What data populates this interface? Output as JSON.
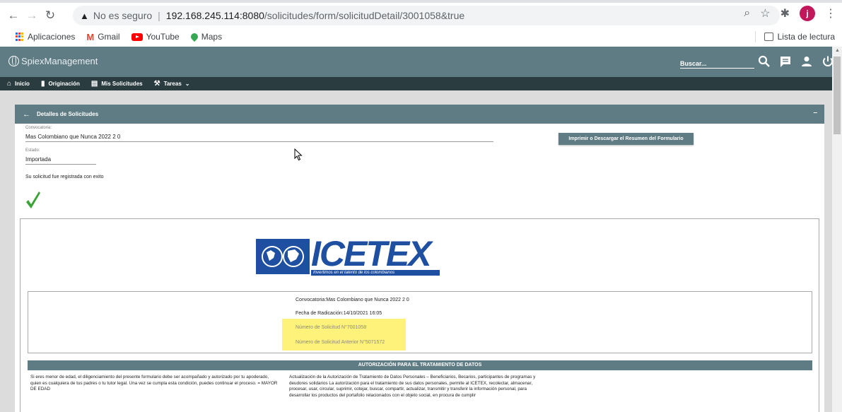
{
  "browser": {
    "url_warning": "No es seguro",
    "url_host": "192.168.245.114:8080",
    "url_path": "/solicitudes/form/solicitudDetail/3001058&true",
    "avatar_letter": "j",
    "bookmarks": [
      {
        "label": "Aplicaciones",
        "icon": "apps-grid-icon"
      },
      {
        "label": "Gmail",
        "icon": "gmail-icon"
      },
      {
        "label": "YouTube",
        "icon": "youtube-icon"
      },
      {
        "label": "Maps",
        "icon": "maps-icon"
      }
    ],
    "reading_list": "Lista de lectura"
  },
  "app": {
    "brand": "SpiexManagement",
    "search_placeholder": "Buscar...",
    "nav": [
      {
        "label": "Inicio",
        "icon": "home-icon"
      },
      {
        "label": "Originación",
        "icon": "document-icon"
      },
      {
        "label": "Mis Solicitudes",
        "icon": "folder-icon"
      },
      {
        "label": "Tareas",
        "icon": "wrench-icon"
      }
    ]
  },
  "panel": {
    "title": "Detalles de Solicitudes",
    "minimize": "–",
    "convocatoria_label": "Convocatoria:",
    "convocatoria_value": "Mas Colombiano que Nunca 2022 2 0",
    "estado_label": "Estado:",
    "estado_value": "Importada",
    "print_button": "Imprimir o Descargar el Resumen del Formulario",
    "success_message": "Su solicitud fue registrada con exito"
  },
  "summary": {
    "logo_word": "ICETEX",
    "logo_tagline": "Invertimos en el talento de los colombianos",
    "convocatoria": "Convocatoria:Mas Colombiano que Nunca 2022 2 0",
    "fecha": "Fecha de Radicación:14/10/2021 16:05",
    "numero_solicitud": "Número de Solicitud N°7001058",
    "numero_anterior": "Número de Solicitud Anterior N°5071572",
    "auth_title": "AUTORIZACIÓN PARA EL TRATAMIENTO DE DATOS",
    "auth_left": "Si eres menor de edad, el diligenciamiento del presente formulario debe ser acompañado y autorizado por tu apoderado, quien es cualquiera de tus padres o tu tutor legal. Una vez se cumpla esta condición, puedes continuar el proceso. = MAYOR DE EDAD",
    "auth_right": "Actualización de la Autorización de Tratamiento de Datos Personales – Beneficiarios, Becarios, participantes de programas y deudores solidarios La autorización para el tratamiento de sus datos personales, permite al ICETEX, recolectar, almacenar, procesar, usar, circular, suprimir, cotejar, buscar, compartir, actualizar, transmitir y transferir la información personal, para desarrollar los productos del portafolio relacionados con el objeto social, en procura de cumplir"
  },
  "colors": {
    "header": "#5f7b83",
    "nav": "#2b3c41",
    "highlight": "#fff27a",
    "icetex_blue": "#1f4fa0",
    "check_green": "#3aa335"
  }
}
